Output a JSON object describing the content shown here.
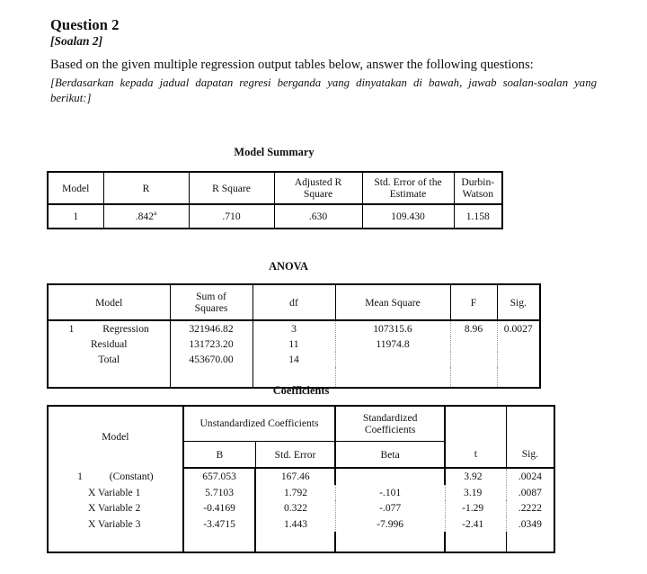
{
  "header": {
    "title": "Question 2",
    "subtitle": "[Soalan 2]",
    "paragraph_en": "Based on the given multiple regression output tables below, answer the following questions:",
    "paragraph_my": "[Berdasarkan kepada jadual dapatan regresi berganda yang dinyatakan di bawah, jawab soalan-soalan yang berikut:]"
  },
  "model_summary": {
    "caption": "Model Summary",
    "columns": [
      "Model",
      "R",
      "R Square",
      "Adjusted R Square",
      "Std. Error of the Estimate",
      "Durbin-Watson"
    ],
    "columns_wrapped": {
      "adjusted_r_square_l1": "Adjusted R",
      "adjusted_r_square_l2": "Square",
      "std_error_l1": "Std. Error of the",
      "std_error_l2": "Estimate",
      "durbin_watson_l1": "Durbin-",
      "durbin_watson_l2": "Watson"
    },
    "rows": [
      {
        "model": "1",
        "r": ".842",
        "r_superscript": "a",
        "r_square": ".710",
        "adjusted_r_square": ".630",
        "std_error_estimate": "109.430",
        "durbin_watson": "1.158"
      }
    ]
  },
  "anova": {
    "caption": "ANOVA",
    "columns": [
      "Model",
      "Sum of Squares",
      "df",
      "Mean Square",
      "F",
      "Sig."
    ],
    "columns_wrapped": {
      "sum_of_squares_l1": "Sum of",
      "sum_of_squares_l2": "Squares"
    },
    "model_number": "1",
    "rows": [
      {
        "source": "Regression",
        "sum_of_squares": "321946.82",
        "df": "3",
        "mean_square": "107315.6",
        "f": "8.96",
        "sig": "0.0027"
      },
      {
        "source": "Residual",
        "sum_of_squares": "131723.20",
        "df": "11",
        "mean_square": "11974.8",
        "f": "",
        "sig": ""
      },
      {
        "source": "Total",
        "sum_of_squares": "453670.00",
        "df": "14",
        "mean_square": "",
        "f": "",
        "sig": ""
      }
    ]
  },
  "coefficients": {
    "caption": "Coefficients",
    "group_headers": {
      "unstandardized": "Unstandardized Coefficients",
      "standardized_l1": "Standardized",
      "standardized_l2": "Coefficients"
    },
    "columns": [
      "Model",
      "B",
      "Std. Error",
      "Beta",
      "t",
      "Sig."
    ],
    "model_number": "1",
    "rows": [
      {
        "term": "(Constant)",
        "b": "657.053",
        "std_error": "167.46",
        "beta": "",
        "t": "3.92",
        "sig": ".0024"
      },
      {
        "term": "X Variable 1",
        "b": "5.7103",
        "std_error": "1.792",
        "beta": "-.101",
        "t": "3.19",
        "sig": ".0087"
      },
      {
        "term": "X Variable 2",
        "b": "-0.4169",
        "std_error": "0.322",
        "beta": "-.077",
        "t": "-1.29",
        "sig": ".2222"
      },
      {
        "term": "X Variable 3",
        "b": "-3.4715",
        "std_error": "1.443",
        "beta": "-7.996",
        "t": "-2.41",
        "sig": ".0349"
      }
    ]
  }
}
